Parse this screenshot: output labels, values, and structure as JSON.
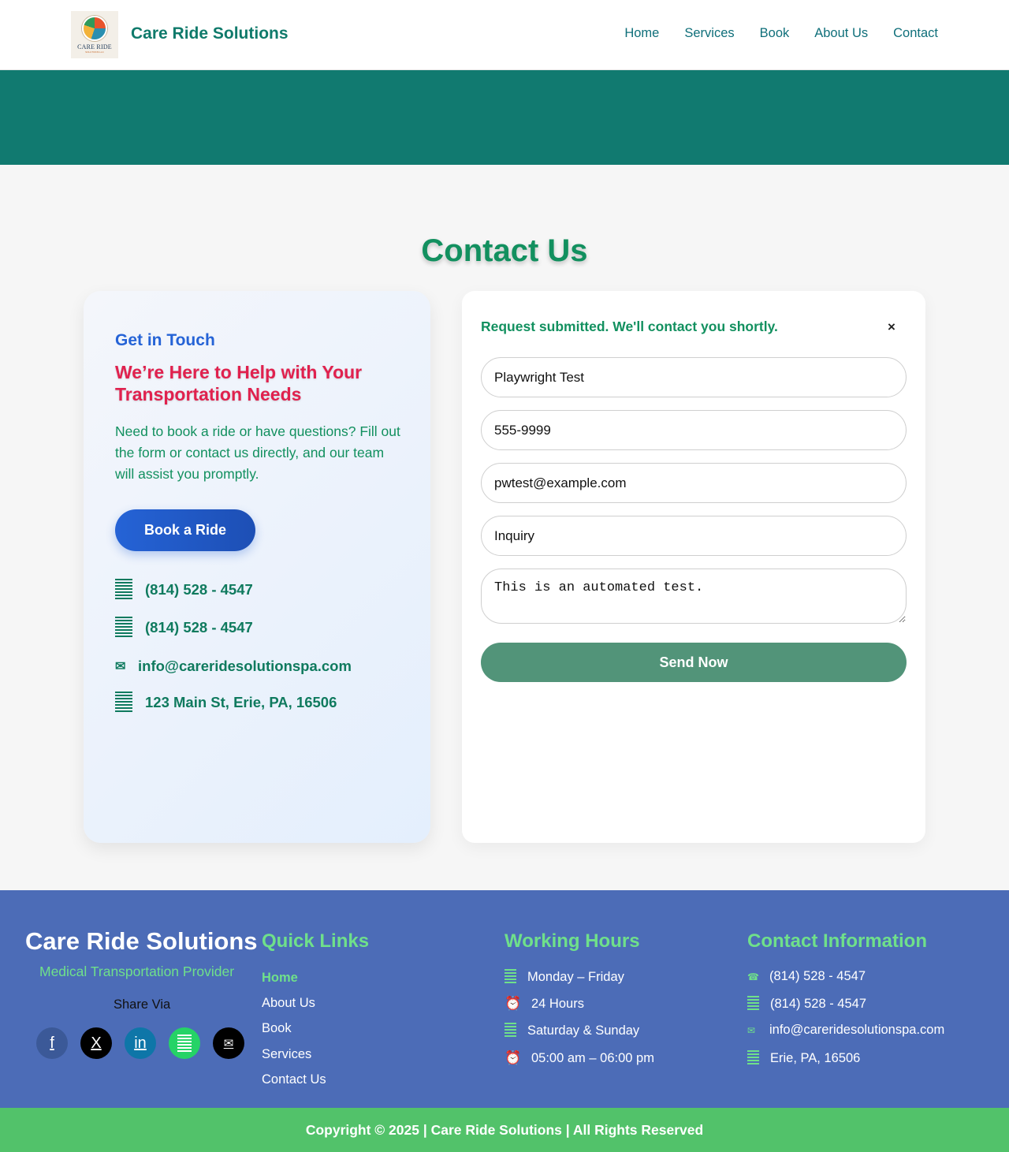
{
  "header": {
    "logo_text": "CARE RIDE",
    "logo_subtext": "SOLUTIONS LLC",
    "brand": "Care Ride Solutions",
    "nav": [
      "Home",
      "Services",
      "Book",
      "About Us",
      "Contact"
    ]
  },
  "main": {
    "title": "Contact Us",
    "info": {
      "eyebrow": "Get in Touch",
      "headline": "We’re Here to Help with Your Transportation Needs",
      "description": "Need to book a ride or have questions? Fill out the form or contact us directly, and our team will assist you promptly.",
      "book_label": "Book a Ride",
      "phone_1": "(814) 528 - 4547",
      "phone_2": "(814) 528 - 4547",
      "email": "info@careridesolutionspa.com",
      "address": "123 Main St, Erie, PA, 16506"
    },
    "form": {
      "success_message": "Request submitted. We'll contact you shortly.",
      "close_label": "×",
      "name_value": "Playwright Test",
      "phone_value": "555-9999",
      "email_value": "pwtest@example.com",
      "subject_value": "Inquiry",
      "message_value": "This is an automated test.",
      "submit_label": "Send Now"
    }
  },
  "footer": {
    "brand": "Care Ride Solutions",
    "tagline": "Medical Transportation Provider",
    "share_label": "Share Via",
    "social": [
      {
        "label": "f",
        "icon": "facebook-icon",
        "color": "#3b5998"
      },
      {
        "label": "X",
        "icon": "x-icon",
        "color": "#000000"
      },
      {
        "label": "in",
        "icon": "linkedin-icon",
        "color": "#0e76a8"
      },
      {
        "label": "",
        "icon": "whatsapp-icon",
        "color": "#25d366"
      },
      {
        "label": "✉",
        "icon": "email-icon",
        "color": "#000000"
      }
    ],
    "quick_links_title": "Quick Links",
    "quick_links": [
      "Home",
      "About Us",
      "Book",
      "Services",
      "Contact Us"
    ],
    "hours_title": "Working Hours",
    "hours": {
      "weekday_label": "Monday – Friday",
      "weekday_hours": "24 Hours",
      "weekend_label": "Saturday & Sunday",
      "weekend_hours": "05:00 am – 06:00 pm"
    },
    "contact_title": "Contact Information",
    "contact": {
      "phone_1": "(814) 528 - 4547",
      "phone_2": "(814) 528 - 4547",
      "email": "info@careridesolutionspa.com",
      "location": "Erie, PA, 16506"
    },
    "copyright": "Copyright © 2025 | Care Ride Solutions | All Rights Reserved"
  },
  "colors": {
    "brand_teal": "#117a70",
    "accent_green": "#12905f",
    "accent_blue": "#2563d6",
    "accent_red": "#e0214e",
    "footer_blue": "#4c6cb7",
    "footer_green": "#52c26a"
  }
}
